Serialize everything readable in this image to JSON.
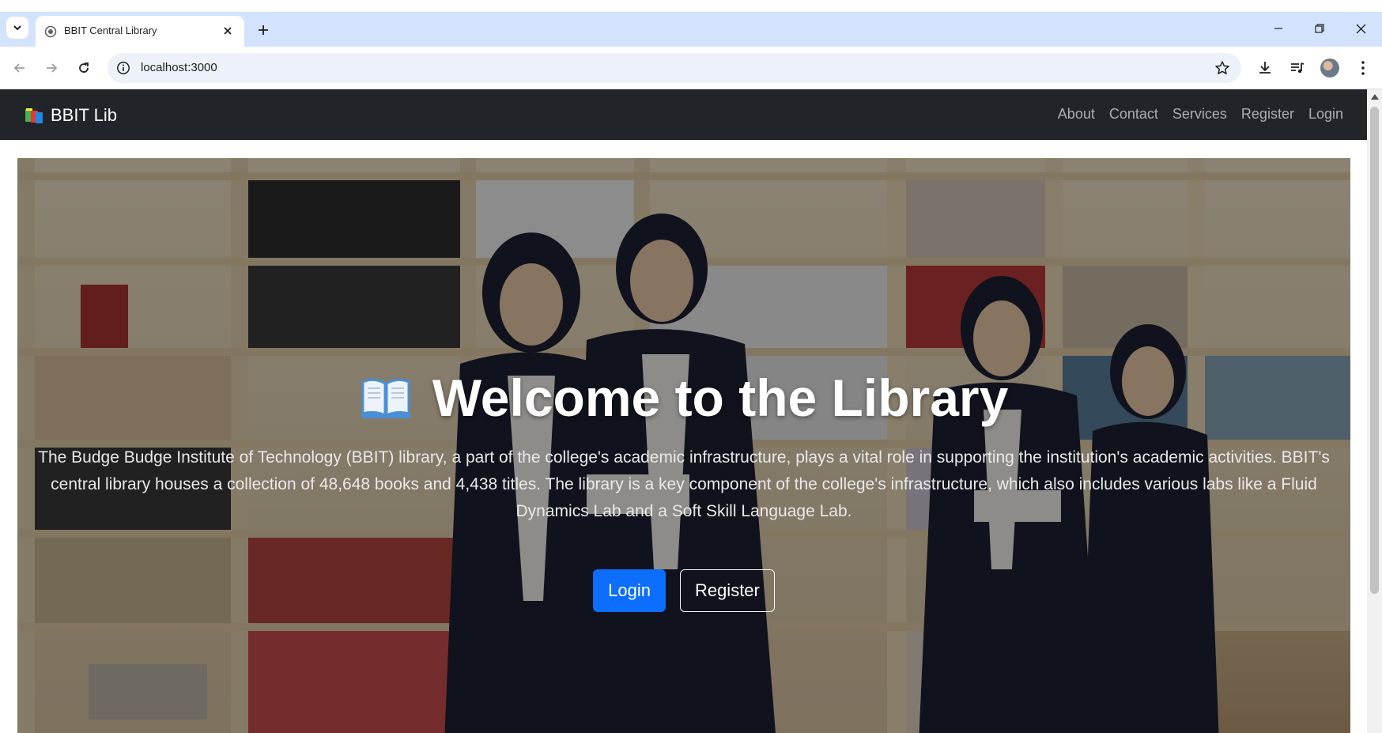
{
  "browser": {
    "tab_title": "BBIT Central Library",
    "url": "localhost:3000"
  },
  "navbar": {
    "brand": "BBIT Lib",
    "links": [
      "About",
      "Contact",
      "Services",
      "Register",
      "Login"
    ]
  },
  "hero": {
    "title": "Welcome to the Library",
    "description": "The Budge Budge Institute of Technology (BBIT) library, a part of the college's academic infrastructure, plays a vital role in supporting the institution's academic activities. BBIT's central library houses a collection of 48,648 books and 4,438 titles. The library is a key component of the college's infrastructure, which also includes various labs like a Fluid Dynamics Lab and a Soft Skill Language Lab.",
    "login_button": "Login",
    "register_button": "Register"
  },
  "colors": {
    "navbar_bg": "#212529",
    "primary": "#0d6efd",
    "tabbar_bg": "#d3e3fd",
    "omnibox_bg": "#edf2fa"
  },
  "icons": {
    "brand": "books-icon",
    "hero": "open-book-icon"
  }
}
